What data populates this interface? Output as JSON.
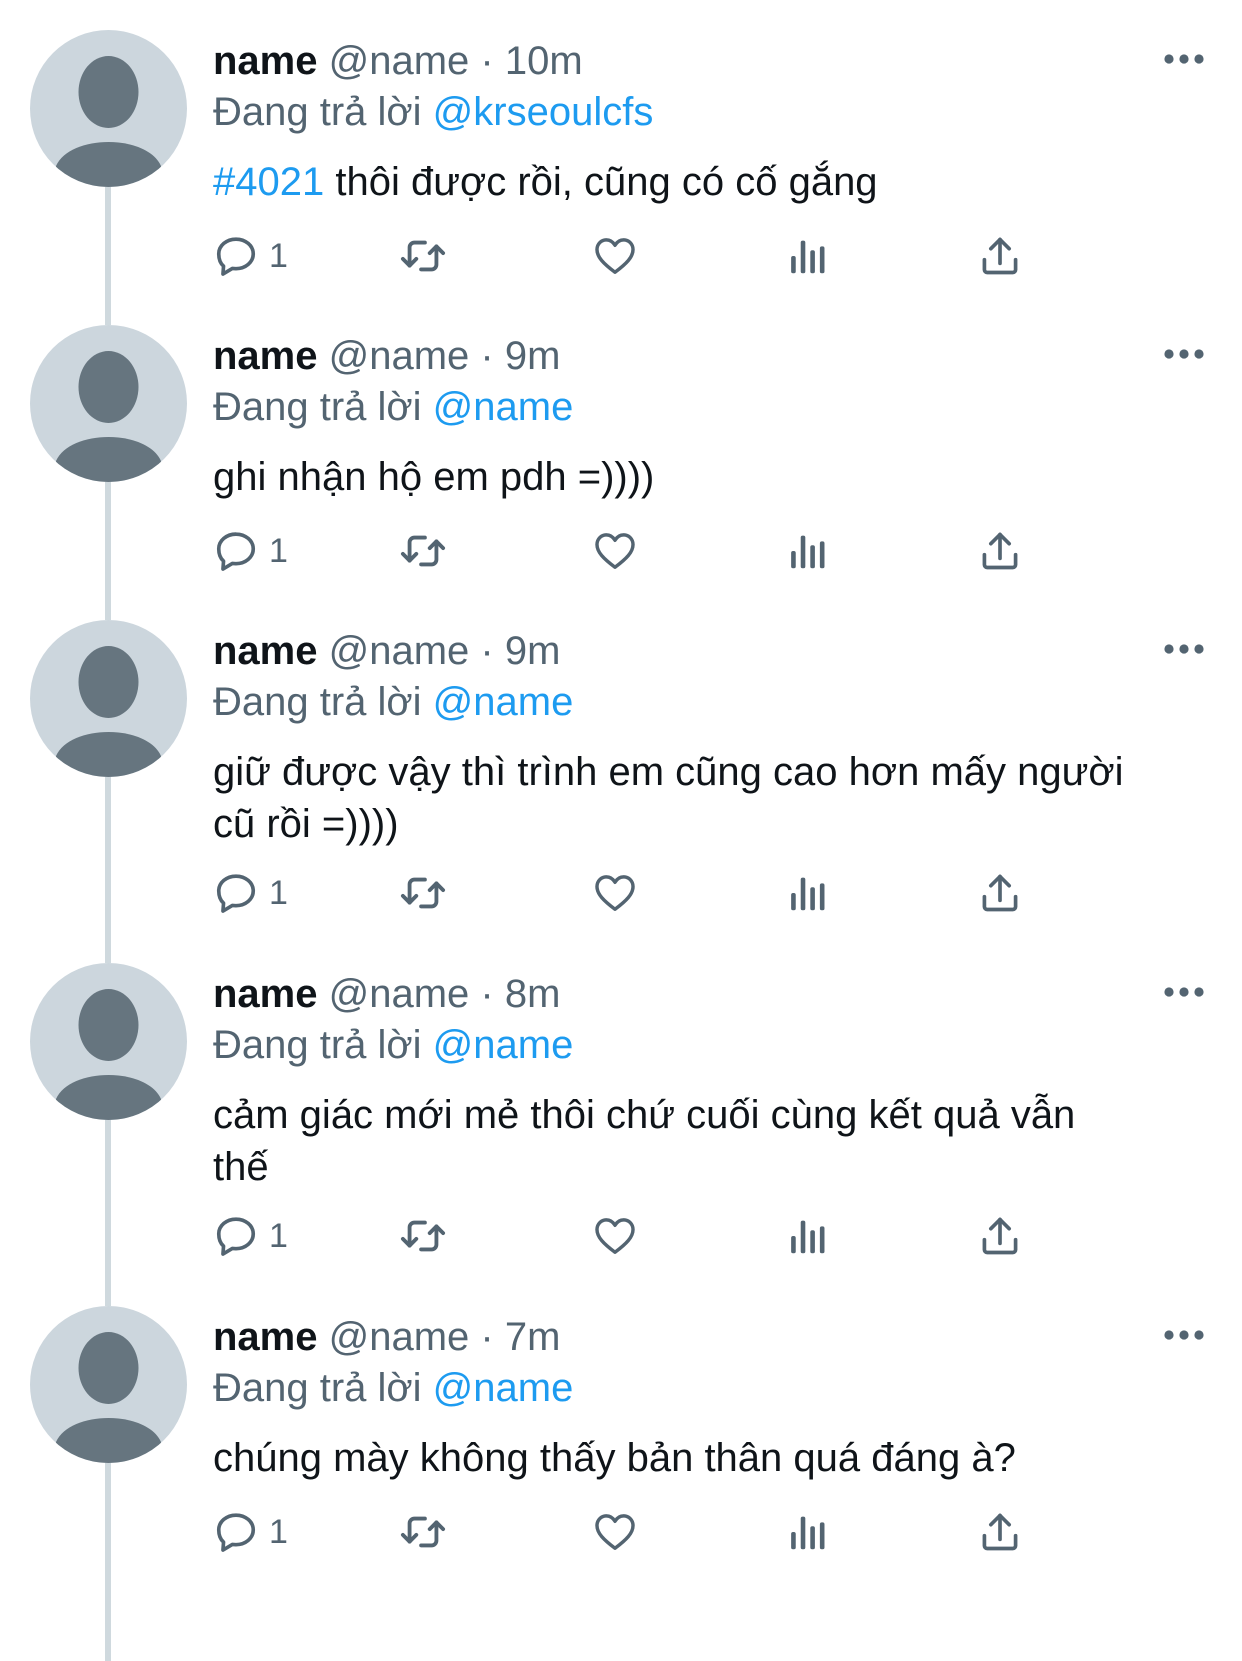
{
  "tweets": [
    {
      "display_name": "name",
      "handle": "@name",
      "separator": "·",
      "time": "10m",
      "replying_prefix": "Đang trả lời",
      "replying_to": "@krseoulcfs",
      "text_lines": [
        {
          "hashtag": "#4021",
          "rest": " thôi được rồi, cũng có cố gắng"
        }
      ],
      "reply_count": "1"
    },
    {
      "display_name": "name",
      "handle": "@name",
      "separator": "·",
      "time": "9m",
      "replying_prefix": "Đang trả lời",
      "replying_to": "@name",
      "text_lines": [
        {
          "hashtag": "",
          "rest": "ghi nhận hộ em pdh =))))"
        }
      ],
      "reply_count": "1"
    },
    {
      "display_name": "name",
      "handle": "@name",
      "separator": "·",
      "time": "9m",
      "replying_prefix": "Đang trả lời",
      "replying_to": "@name",
      "text_lines": [
        {
          "hashtag": "",
          "rest": "giữ được vậy thì trình em cũng cao hơn mấy người"
        },
        {
          "hashtag": "",
          "rest": "cũ rồi =))))"
        }
      ],
      "reply_count": "1"
    },
    {
      "display_name": "name",
      "handle": "@name",
      "separator": "·",
      "time": "8m",
      "replying_prefix": "Đang trả lời",
      "replying_to": "@name",
      "text_lines": [
        {
          "hashtag": "",
          "rest": "cảm giác mới mẻ thôi chứ cuối cùng kết quả vẫn"
        },
        {
          "hashtag": "",
          "rest": "thế"
        }
      ],
      "reply_count": "1"
    },
    {
      "display_name": "name",
      "handle": "@name",
      "separator": "·",
      "time": "7m",
      "replying_prefix": "Đang trả lời",
      "replying_to": "@name",
      "text_lines": [
        {
          "hashtag": "",
          "rest": "chúng mày không thấy bản thân quá đáng à?"
        }
      ],
      "reply_count": "1"
    }
  ],
  "icons": {
    "more": "more-horizontal-icon",
    "reply": "reply-bubble-icon",
    "retweet": "retweet-icon",
    "like": "heart-icon",
    "views": "analytics-bars-icon",
    "share": "share-upload-icon",
    "avatar": "default-profile-avatar-icon"
  },
  "colors": {
    "link": "#1d9bf0",
    "secondary_text": "#536471",
    "primary_text": "#0f1419",
    "avatar_bg": "#ccd6dd",
    "avatar_figure": "#66757f",
    "thread_line": "#cfd9de"
  }
}
